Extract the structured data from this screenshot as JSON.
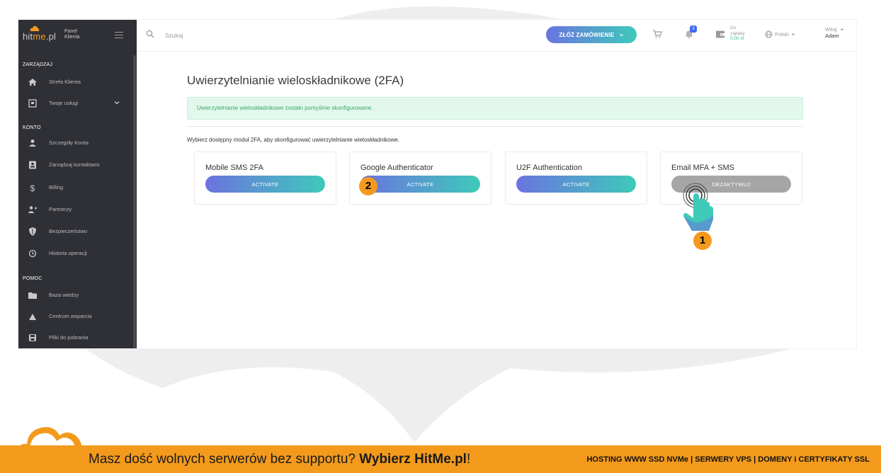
{
  "brand": {
    "logo_text_1": "hit",
    "logo_text_2": "me",
    "logo_text_3": ".pl",
    "panel_label_1": "Panel",
    "panel_label_2": "Klienta"
  },
  "sidebar": {
    "sections": [
      {
        "title": "ZARZĄDZAJ"
      },
      {
        "title": "KONTO"
      },
      {
        "title": "POMOC"
      }
    ],
    "items": [
      {
        "label": "Strefa Klienta",
        "icon": "home-icon"
      },
      {
        "label": "Twoje usługi",
        "icon": "services-icon"
      },
      {
        "label": "Szczegóły Konta",
        "icon": "user-icon"
      },
      {
        "label": "Zarządzaj kontaktami",
        "icon": "contacts-icon"
      },
      {
        "label": "Billing",
        "icon": "dollar-icon"
      },
      {
        "label": "Partnerzy",
        "icon": "partners-icon"
      },
      {
        "label": "Bezpieczeństwo",
        "icon": "shield-icon"
      },
      {
        "label": "Historia operacji",
        "icon": "history-icon"
      },
      {
        "label": "Baza wiedzy",
        "icon": "folder-icon"
      },
      {
        "label": "Centrum wsparcia",
        "icon": "support-icon"
      },
      {
        "label": "Pliki do pobrania",
        "icon": "download-icon"
      }
    ]
  },
  "topbar": {
    "search_placeholder": "Szukaj",
    "order_button": "ZŁÓŻ ZAMÓWIENIE",
    "notification_count": "3",
    "due_label_1": "Do",
    "due_label_2": "zapłaty",
    "due_amount": "0,00 zł",
    "language": "Polski",
    "greeting": "Witaj",
    "user_name": "Adam"
  },
  "main": {
    "title": "Uwierzytelnianie wieloskładnikowe (2FA)",
    "success_message": "Uwierzytelnianie wieloskładnikowe zostało pomyślnie skonfigurowane.",
    "intro": "Wybierz dostępny moduł 2FA, aby skonfigurować uwierzytelnianie wieloskładnikowe.",
    "modules": [
      {
        "name": "Mobile SMS 2FA",
        "button": "ACTIVATE"
      },
      {
        "name": "Google Authenticator",
        "button": "ACTIVATE"
      },
      {
        "name": "U2F Authentication",
        "button": "ACTIVATE"
      },
      {
        "name": "Email MFA + SMS",
        "button": "DEZAKTYWUJ"
      }
    ]
  },
  "annotations": {
    "step_1": "1",
    "step_2": "2"
  },
  "footer": {
    "tagline_prefix": "Masz dość wolnych serwerów bez supportu? ",
    "tagline_brand": "Wybierz HitMe.pl",
    "tagline_suffix": "!",
    "services": "HOSTING WWW SSD NVMe | SERWERY VPS | DOMENY i CERTYFIKATY SSL"
  },
  "colors": {
    "accent": "#f39a1d",
    "gradient_start": "#6b73e0",
    "gradient_end": "#3ecab9",
    "sidebar_bg": "#2f3035",
    "success_bg": "#e3f8ec"
  }
}
